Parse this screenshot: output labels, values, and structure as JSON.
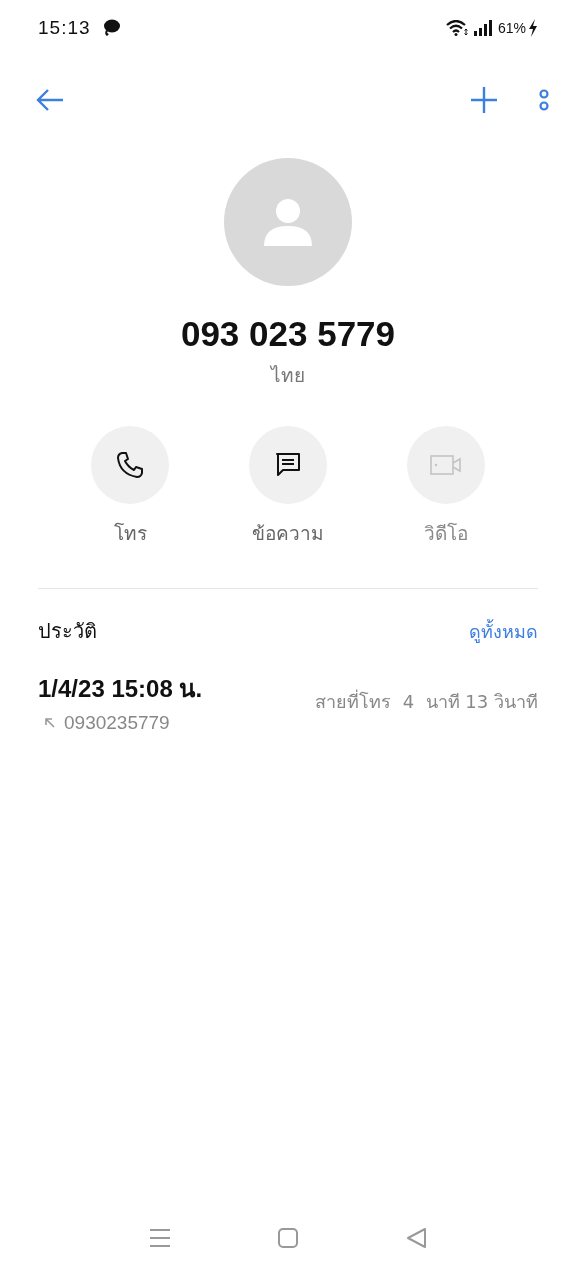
{
  "status_bar": {
    "time": "15:13",
    "battery": "61%"
  },
  "contact": {
    "name": "093 023 5779",
    "location": "ไทย"
  },
  "actions": [
    {
      "kind": "call",
      "label": "โทร",
      "disabled": false
    },
    {
      "kind": "message",
      "label": "ข้อความ",
      "disabled": false
    },
    {
      "kind": "video",
      "label": "วิดีโอ",
      "disabled": true
    }
  ],
  "history": {
    "title": "ประวัติ",
    "view_all": "ดูทั้งหมด",
    "entries": [
      {
        "datetime": "1/4/23 15:08 น.",
        "number": "0930235779",
        "kind": "outgoing",
        "duration": "สายที่โทร  4  นาที 13 วินาที"
      }
    ]
  }
}
